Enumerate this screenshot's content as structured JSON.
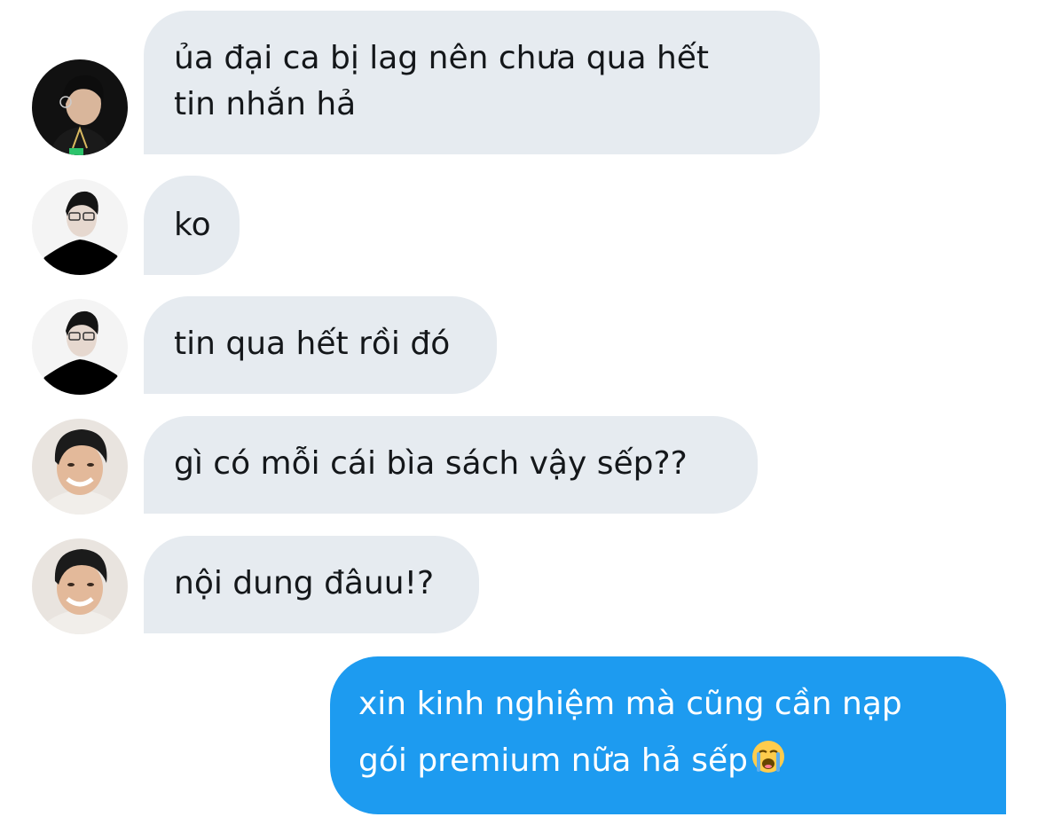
{
  "messages": [
    {
      "author": "user-a",
      "lines": [
        "ủa đại ca bị lag nên chưa qua hết",
        "tin nhắn hả"
      ]
    },
    {
      "author": "user-b",
      "lines": [
        "ko"
      ]
    },
    {
      "author": "user-b",
      "lines": [
        "tin qua hết rồi đó"
      ]
    },
    {
      "author": "user-c",
      "lines": [
        "gì có mỗi cái bìa sách vậy sếp??"
      ]
    },
    {
      "author": "user-c",
      "lines": [
        "nội dung đâuu!?"
      ]
    },
    {
      "author": "me",
      "lines": [
        "xin kinh nghiệm mà cũng cần nạp",
        "gói premium nữa hả sếp"
      ],
      "emoji": "loudly-crying-face-emoji"
    }
  ],
  "colors": {
    "received_bubble": "#e6ebf0",
    "sent_bubble": "#1d9bf0",
    "received_text": "#14171a",
    "sent_text": "#ffffff"
  }
}
